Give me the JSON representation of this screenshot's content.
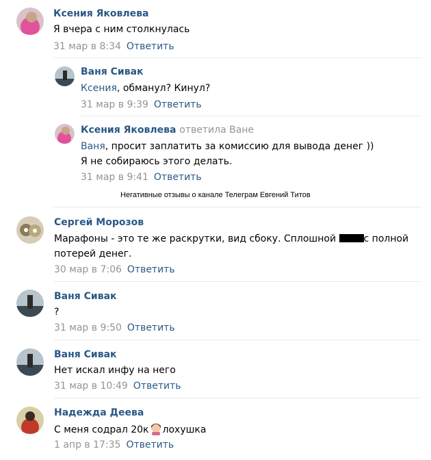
{
  "reply_label": "Ответить",
  "caption": "Негативные отзывы о канале Телеграм Евгений Титов",
  "comments": [
    {
      "author": "Ксения Яковлева",
      "text": "Я вчера с ним столкнулась",
      "date": "31 мар в 8:34"
    },
    {
      "author": "Ваня Сивак",
      "mention": "Ксения",
      "text": ", обманул? Кинул?",
      "date": "31 мар в 9:39"
    },
    {
      "author": "Ксения Яковлева",
      "replied_to": "ответила Ване",
      "mention": "Ваня",
      "text": ", просит заплатить за комиссию для вывода денег ))",
      "text2": "Я не собираюсь этого делать.",
      "date": "31 мар в 9:41"
    },
    {
      "author": "Сергей Морозов",
      "text": "Марафоны - это те же раскрутки, вид сбоку. Сплошной ",
      "text_after": "с полной",
      "text2": "потерей денег.",
      "date": "30 мар в 7:06"
    },
    {
      "author": "Ваня Сивак",
      "text": "?",
      "date": "31 мар в 9:50"
    },
    {
      "author": "Ваня Сивак",
      "text": "Нет искал инфу на него",
      "date": "31 мар в 10:49"
    },
    {
      "author": "Надежда Деева",
      "text": "С меня содрал 20к",
      "text_after": "лохушка",
      "date": "1 апр в 17:35"
    }
  ],
  "colors": {
    "link": "#2a5885",
    "meta": "#939393",
    "divider": "#e7e8ec"
  }
}
